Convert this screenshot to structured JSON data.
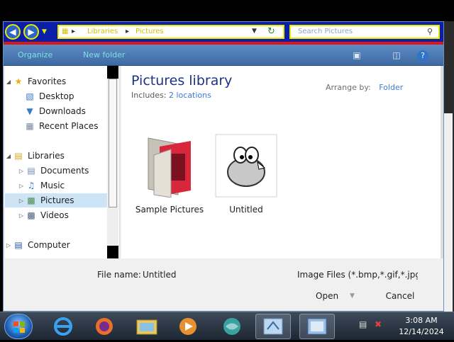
{
  "address": {
    "crumb1": "Libraries",
    "crumb2": "Pictures",
    "search_placeholder": "Search Pictures"
  },
  "toolbar": {
    "organize": "Organize",
    "new_folder": "New folder"
  },
  "nav": {
    "favorites": "Favorites",
    "desktop": "Desktop",
    "downloads": "Downloads",
    "recent": "Recent Places",
    "libraries": "Libraries",
    "documents": "Documents",
    "music": "Music",
    "pictures": "Pictures",
    "videos": "Videos",
    "computer": "Computer"
  },
  "content": {
    "title": "Pictures library",
    "includes_label": "Includes:",
    "includes_link": "2 locations",
    "arrange_label": "Arrange by:",
    "arrange_value": "Folder",
    "items": [
      {
        "label": "Sample Pictures"
      },
      {
        "label": "Untitled"
      }
    ]
  },
  "footer": {
    "filename_label": "File name:",
    "filename_value": "Untitled",
    "filter": "Image Files (*.bmp,*.gif,*.jpg,*.",
    "open": "Open",
    "cancel": "Cancel"
  },
  "clock": {
    "time": "3:08 AM",
    "date": "12/14/2024"
  },
  "colors": {
    "title_blue": "#1e3287",
    "link_blue": "#3a7ad6",
    "address_bar": "#0a1ea8",
    "highlight_yellow": "#e8e800"
  }
}
